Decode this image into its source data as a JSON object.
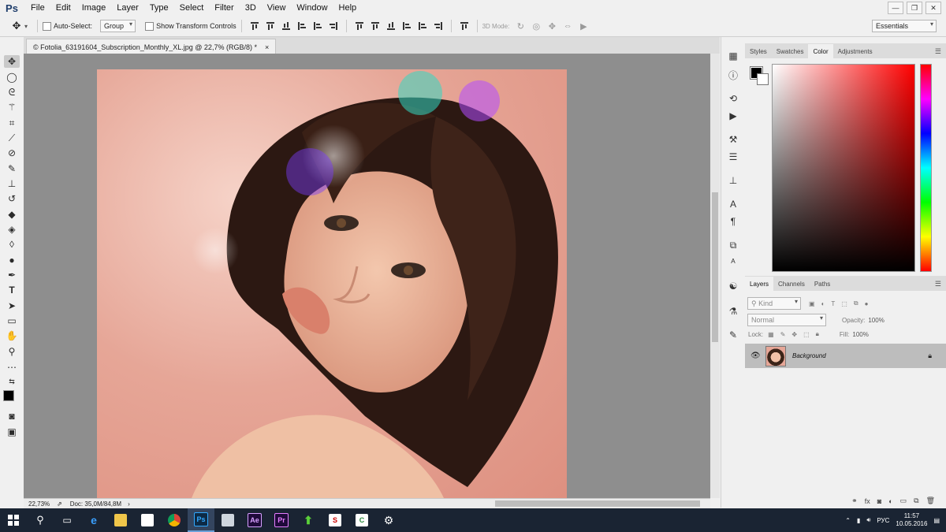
{
  "app": {
    "logo": "Ps"
  },
  "menubar": {
    "items": [
      "File",
      "Edit",
      "Image",
      "Layer",
      "Type",
      "Select",
      "Filter",
      "3D",
      "View",
      "Window",
      "Help"
    ]
  },
  "window_controls": {
    "minimize": "—",
    "restore": "❐",
    "close": "✕"
  },
  "options_bar": {
    "auto_select_label": "Auto-Select:",
    "auto_select_target": "Group",
    "show_transform_label": "Show Transform Controls",
    "mode_3d_label": "3D Mode:",
    "workspace": "Essentials"
  },
  "document_tab": {
    "title": "Fotolia_63191604_Subscription_Monthly_XL.jpg @ 22,7% (RGB/8) *",
    "close": "×",
    "prefix": "©"
  },
  "status_bar": {
    "zoom": "22,73%",
    "doc_info": "Doc: 35,0M/84,8M"
  },
  "color_panel": {
    "tabs": [
      "Styles",
      "Swatches",
      "Color",
      "Adjustments"
    ],
    "active_tab": "Color",
    "foreground": "#000000",
    "background": "#ffffff"
  },
  "layers_panel": {
    "tabs": [
      "Layers",
      "Channels",
      "Paths"
    ],
    "active_tab": "Layers",
    "filter_kind": "Kind",
    "blend_mode": "Normal",
    "opacity_label": "Opacity:",
    "opacity_value": "100%",
    "lock_label": "Lock:",
    "fill_label": "Fill:",
    "fill_value": "100%",
    "layers": [
      {
        "name": "Background",
        "visible": true,
        "locked": true
      }
    ]
  },
  "taskbar": {
    "language": "РУС",
    "time": "11:57",
    "date": "10.05.2016"
  },
  "colors": {
    "accent": "#1e3d6b",
    "canvas_bg": "#8e8e8e",
    "taskbar": "#1a2433"
  }
}
